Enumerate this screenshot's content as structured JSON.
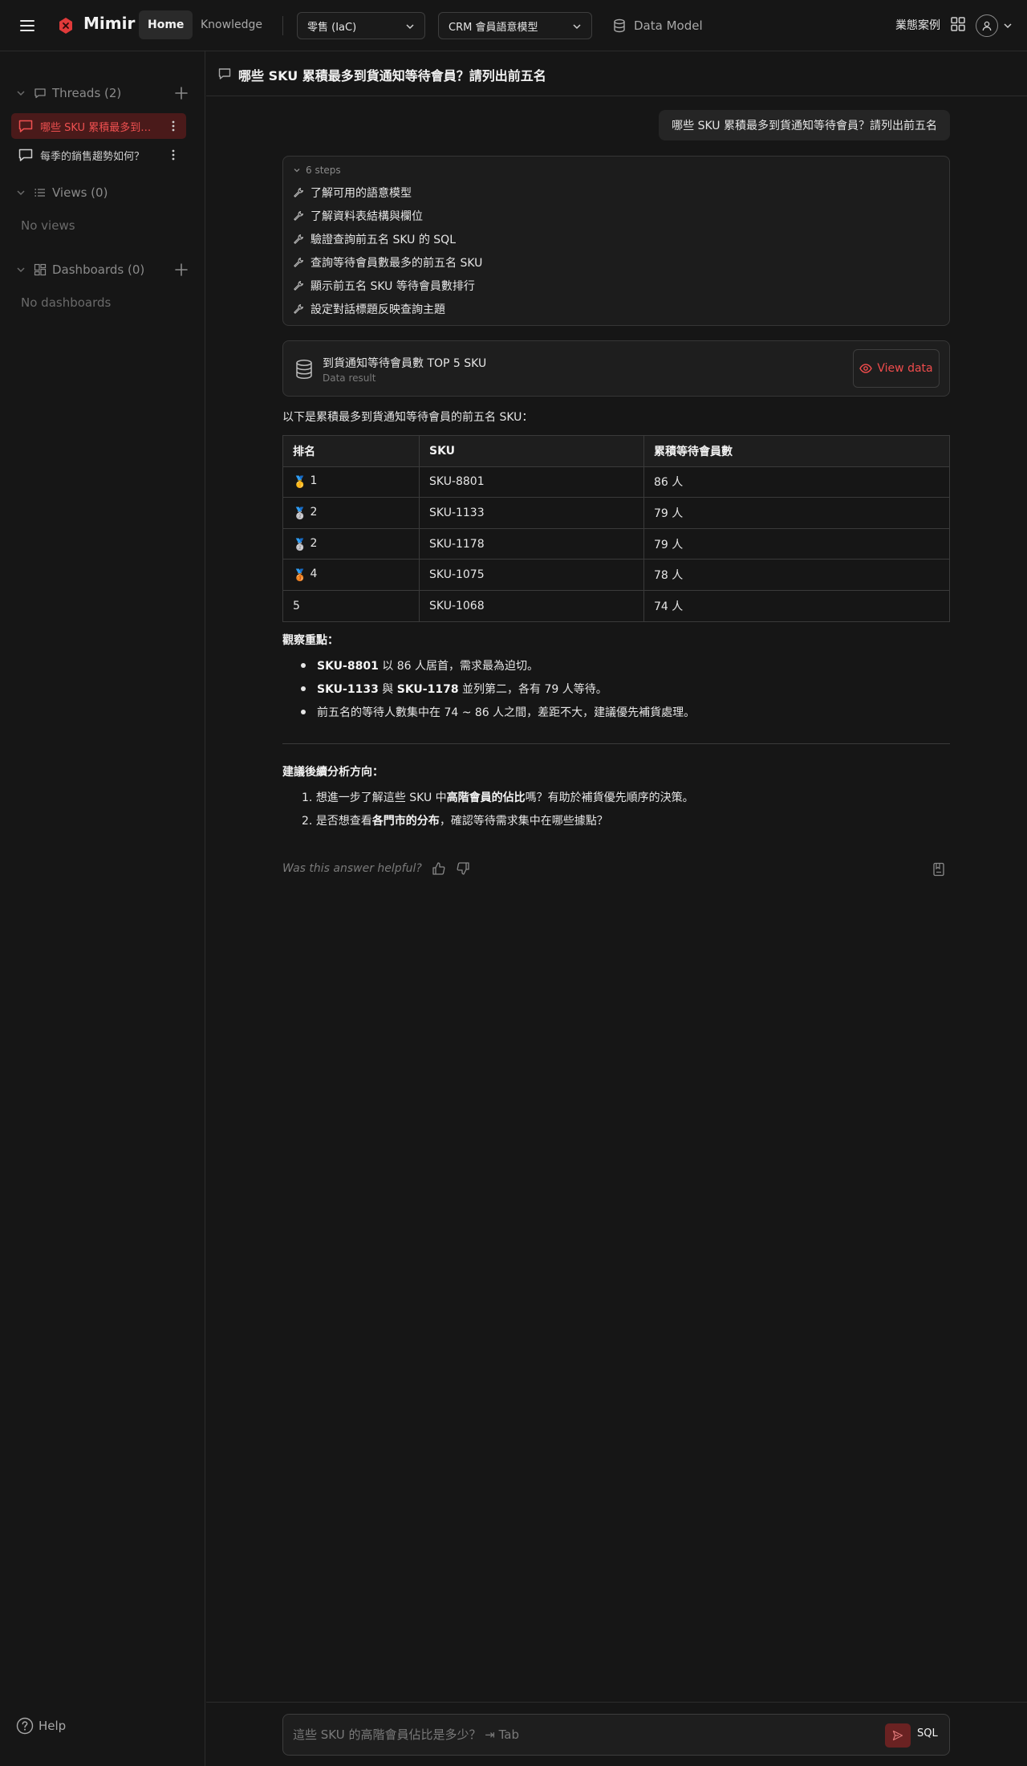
{
  "app": {
    "name": "Mimir"
  },
  "nav": {
    "tabs": [
      {
        "label": "Home"
      },
      {
        "label": "Knowledge"
      }
    ],
    "project_select": "零售 (IaC)",
    "model_select": "CRM 會員語意模型",
    "data_model": "Data Model",
    "use_cases": "業態案例"
  },
  "sidebar": {
    "threads_title": "Threads (2)",
    "threads": [
      {
        "label": "哪些 SKU 累積最多到貨通知等待會員？請列出前五名"
      },
      {
        "label": "每季的銷售趨勢如何？"
      }
    ],
    "views_title": "Views (0)",
    "views_empty": "No views",
    "dashboards_title": "Dashboards (0)",
    "dashboards_empty": "No dashboards",
    "help": "Help"
  },
  "header": {
    "title": "哪些 SKU 累積最多到貨通知等待會員？請列出前五名"
  },
  "chat": {
    "question": "哪些 SKU 累積最多到貨通知等待會員？請列出前五名",
    "steps_label": "6 steps",
    "steps": [
      "了解可用的語意模型",
      "了解資料表結構與欄位",
      "驗證查詢前五名 SKU 的 SQL",
      "查詢等待會員數最多的前五名 SKU",
      "顯示前五名 SKU 等待會員數排行",
      "設定對話標題反映查詢主題"
    ],
    "result_card": {
      "title": "到貨通知等待會員數 TOP 5 SKU",
      "subtitle": "Data result",
      "button": "View data"
    },
    "intro": "以下是累積最多到貨通知等待會員的前五名 SKU：",
    "table": {
      "headers": [
        "排名",
        "SKU",
        "累積等待會員數"
      ],
      "rows": [
        {
          "medal": "🥇",
          "rank": "1",
          "sku": "SKU-8801",
          "count": "86 人"
        },
        {
          "medal": "🥈",
          "rank": "2",
          "sku": "SKU-1133",
          "count": "79 人"
        },
        {
          "medal": "🥈",
          "rank": "2",
          "sku": "SKU-1178",
          "count": "79 人"
        },
        {
          "medal": "🥉",
          "rank": "4",
          "sku": "SKU-1075",
          "count": "78 人"
        },
        {
          "medal": "",
          "rank": "5",
          "sku": "SKU-1068",
          "count": "74 人"
        }
      ]
    },
    "observations_title": "觀察重點：",
    "obs1": {
      "b1": "SKU-8801",
      "t1": " 以 86 人居首，需求最為迫切。"
    },
    "obs2": {
      "b1": "SKU-1133",
      "t1": " 與 ",
      "b2": "SKU-1178",
      "t2": " 並列第二，各有 79 人等待。"
    },
    "obs3": "前五名的等待人數集中在 74 ~ 86 人之間，差距不大，建議優先補貨處理。",
    "next_title": "建議後續分析方向：",
    "next1": {
      "n": "1.",
      "t1": "想進一步了解這些 SKU 中",
      "b1": "高階會員的佔比",
      "t2": "嗎？有助於補貨優先順序的決策。"
    },
    "next2": {
      "n": "2.",
      "t1": "是否想查看",
      "b1": "各門市的分布",
      "t2": "，確認等待需求集中在哪些據點？"
    },
    "feedback": "Was this answer helpful?"
  },
  "composer": {
    "placeholder": "這些 SKU 的高階會員佔比是多少？ ⇥ Tab",
    "sql_label": "SQL"
  },
  "colors": {
    "accent": "#ef4c4c",
    "background": "#161616"
  }
}
